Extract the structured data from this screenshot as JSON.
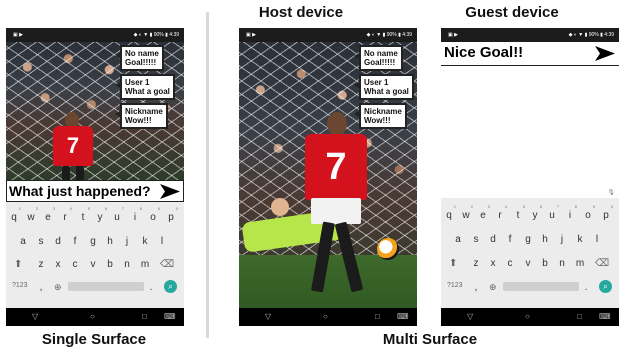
{
  "headings": {
    "host": "Host device",
    "guest": "Guest device",
    "single": "Single Surface",
    "multi": "Multi Surface"
  },
  "statusbar": {
    "left": "▣ ▶",
    "right": "◆ ◐ ▼ ▮ 90% ▮ 4:39"
  },
  "bubbles": [
    {
      "line1": "No name",
      "line2": "Goal!!!!!"
    },
    {
      "line1": "User 1",
      "line2": "What a goal"
    },
    {
      "line1": "Nickname",
      "line2": "Wow!!!"
    }
  ],
  "player": {
    "number": "7"
  },
  "single_input": "What just happened?",
  "guest_input": "Nice Goal!!",
  "keyboard": {
    "row1": [
      "q",
      "w",
      "e",
      "r",
      "t",
      "y",
      "u",
      "i",
      "o",
      "p"
    ],
    "row1_hints": [
      "1",
      "2",
      "3",
      "4",
      "5",
      "6",
      "7",
      "8",
      "9",
      "0"
    ],
    "row2": [
      "a",
      "s",
      "d",
      "f",
      "g",
      "h",
      "j",
      "k",
      "l"
    ],
    "row3": [
      "z",
      "x",
      "c",
      "v",
      "b",
      "n",
      "m"
    ],
    "symbols": "?123",
    "comma": ",",
    "period": ".",
    "mic": "🎙"
  },
  "navbar": {
    "back": "▽",
    "home": "○",
    "recent": "□",
    "kb": "⌨"
  },
  "colors": {
    "shirt": "#d3121e",
    "keeper": "#b6e64a",
    "enter": "#24a99c"
  }
}
